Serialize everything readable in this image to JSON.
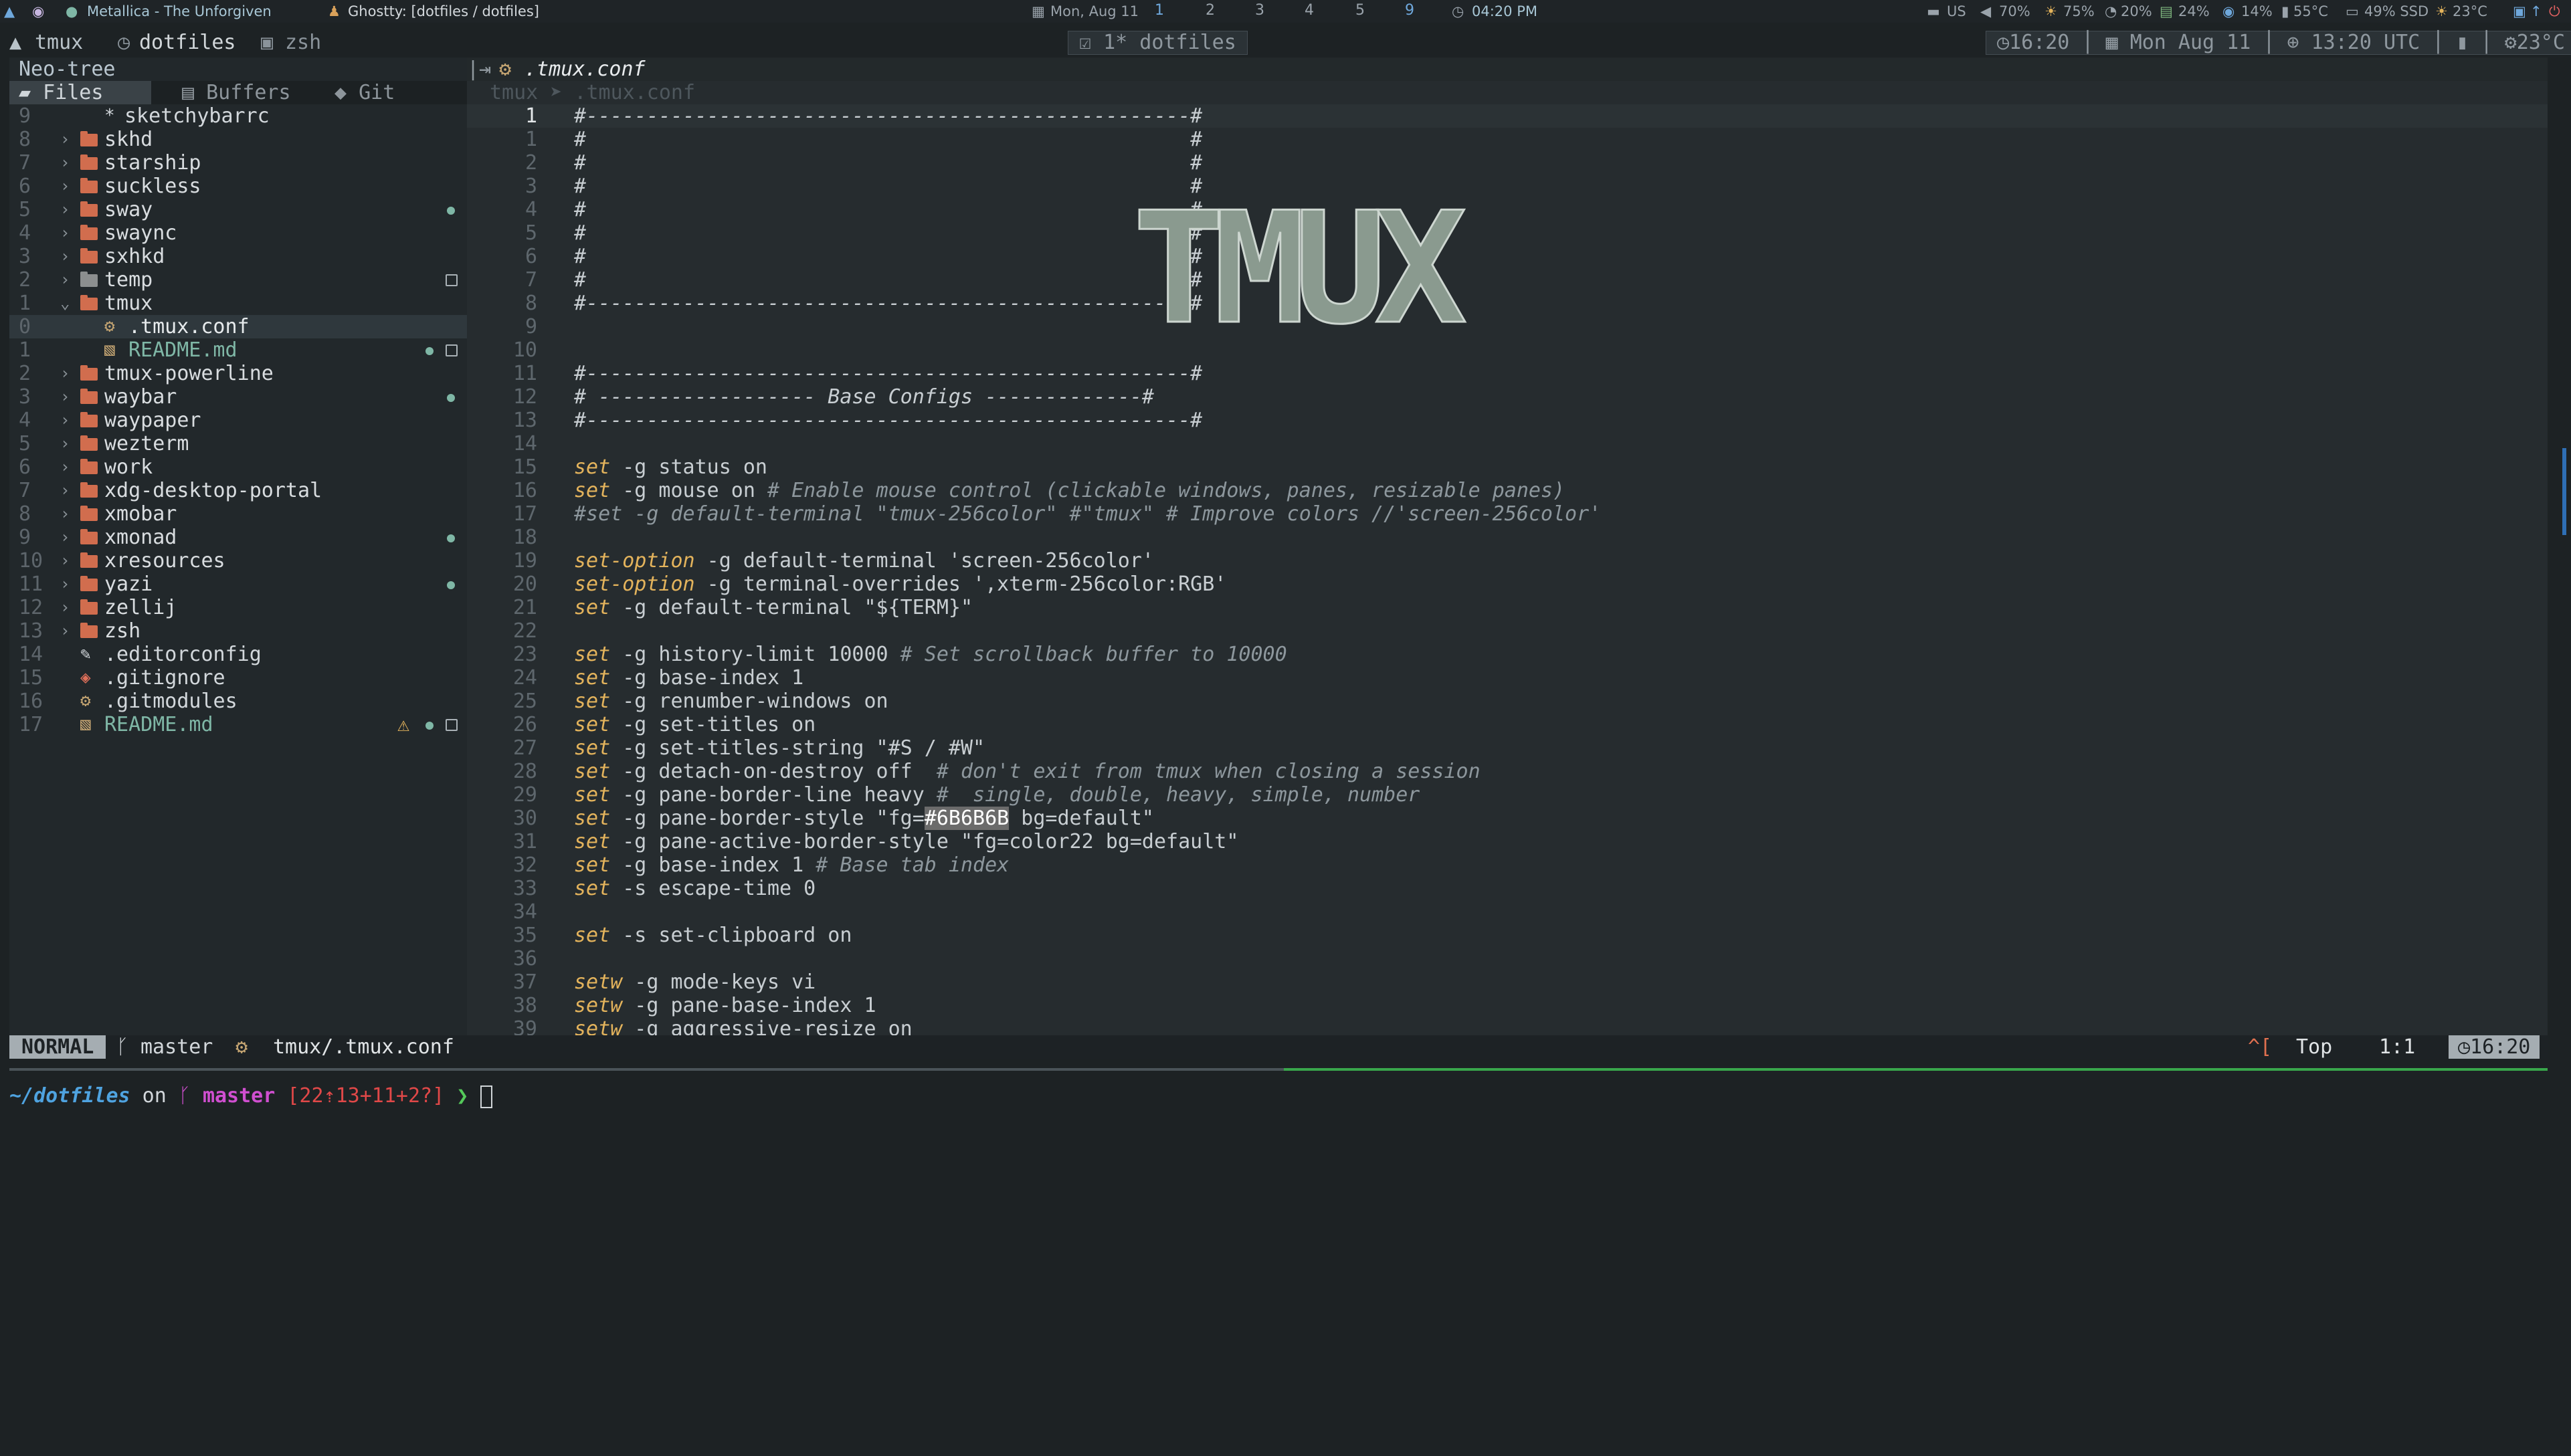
{
  "topbar": {
    "media": "Metallica - The Unforgiven",
    "window_title": "Ghostty: [dotfiles / dotfiles]",
    "date": "Mon, Aug 11",
    "workspaces": [
      "1",
      "2",
      "3",
      "4",
      "5",
      "9"
    ],
    "clock": "04:20 PM",
    "kbd": "US",
    "volume": "70%",
    "brightness": "75%",
    "cpu": "20%",
    "mem": "24%",
    "disk_io": "14%",
    "cpu_temp": "55°C",
    "ssd": "49% SSD",
    "weather": "23°C"
  },
  "tmux": {
    "session": "tmux",
    "windows": [
      "dotfiles",
      "zsh"
    ],
    "center_window": "1* dotfiles",
    "time": "16:20",
    "date": "Mon Aug 11",
    "utc": "13:20 UTC",
    "temp": "23°C"
  },
  "neotree": {
    "title": "Neo-tree",
    "tabs": [
      "Files",
      "Buffers",
      "Git"
    ],
    "rows": [
      {
        "ln": "9",
        "name": "sketchybarrc",
        "kind": "file",
        "depth": 2
      },
      {
        "ln": "8",
        "name": "skhd",
        "kind": "dir",
        "depth": 1
      },
      {
        "ln": "7",
        "name": "starship",
        "kind": "dir",
        "depth": 1
      },
      {
        "ln": "6",
        "name": "suckless",
        "kind": "dir",
        "depth": 1
      },
      {
        "ln": "5",
        "name": "sway",
        "kind": "dir",
        "depth": 1,
        "dot": true
      },
      {
        "ln": "4",
        "name": "swaync",
        "kind": "dir",
        "depth": 1
      },
      {
        "ln": "3",
        "name": "sxhkd",
        "kind": "dir",
        "depth": 1
      },
      {
        "ln": "2",
        "name": "temp",
        "kind": "dir-gray",
        "depth": 1,
        "box": true
      },
      {
        "ln": "1",
        "name": "tmux",
        "kind": "dir-open",
        "depth": 1
      },
      {
        "ln": "0",
        "name": ".tmux.conf",
        "kind": "gear",
        "depth": 2,
        "sel": true
      },
      {
        "ln": "1",
        "name": "README.md",
        "kind": "md",
        "depth": 2,
        "dot": true,
        "box": true
      },
      {
        "ln": "2",
        "name": "tmux-powerline",
        "kind": "dir",
        "depth": 1
      },
      {
        "ln": "3",
        "name": "waybar",
        "kind": "dir",
        "depth": 1,
        "dot": true
      },
      {
        "ln": "4",
        "name": "waypaper",
        "kind": "dir",
        "depth": 1
      },
      {
        "ln": "5",
        "name": "wezterm",
        "kind": "dir",
        "depth": 1
      },
      {
        "ln": "6",
        "name": "work",
        "kind": "dir",
        "depth": 1
      },
      {
        "ln": "7",
        "name": "xdg-desktop-portal",
        "kind": "dir",
        "depth": 1
      },
      {
        "ln": "8",
        "name": "xmobar",
        "kind": "dir",
        "depth": 1
      },
      {
        "ln": "9",
        "name": "xmonad",
        "kind": "dir",
        "depth": 1,
        "dot": true
      },
      {
        "ln": "10",
        "name": "xresources",
        "kind": "dir",
        "depth": 1
      },
      {
        "ln": "11",
        "name": "yazi",
        "kind": "dir",
        "depth": 1,
        "dot": true
      },
      {
        "ln": "12",
        "name": "zellij",
        "kind": "dir",
        "depth": 1
      },
      {
        "ln": "13",
        "name": "zsh",
        "kind": "dir",
        "depth": 1
      },
      {
        "ln": "14",
        "name": ".editorconfig",
        "kind": "pen",
        "depth": 1
      },
      {
        "ln": "15",
        "name": ".gitignore",
        "kind": "git",
        "depth": 1
      },
      {
        "ln": "16",
        "name": ".gitmodules",
        "kind": "gear",
        "depth": 1
      },
      {
        "ln": "17",
        "name": "README.md",
        "kind": "md",
        "depth": 1,
        "warn": true,
        "dot": true,
        "box": true
      }
    ]
  },
  "editor": {
    "tab": ".tmux.conf",
    "breadcrumb": "tmux ➤ .tmux.conf",
    "art_text": "TMUX"
  },
  "statusline": {
    "mode": "NORMAL",
    "branch": "master",
    "file": "tmux/.tmux.conf",
    "keys": "^[",
    "position": "Top",
    "cursor": "1:1",
    "time": "16:20"
  },
  "terminal": {
    "cwd": "~/dotfiles",
    "on": " on ",
    "branch": "master",
    "git_status": "[22⇡13+11+2?]",
    "arrow": "❯"
  }
}
